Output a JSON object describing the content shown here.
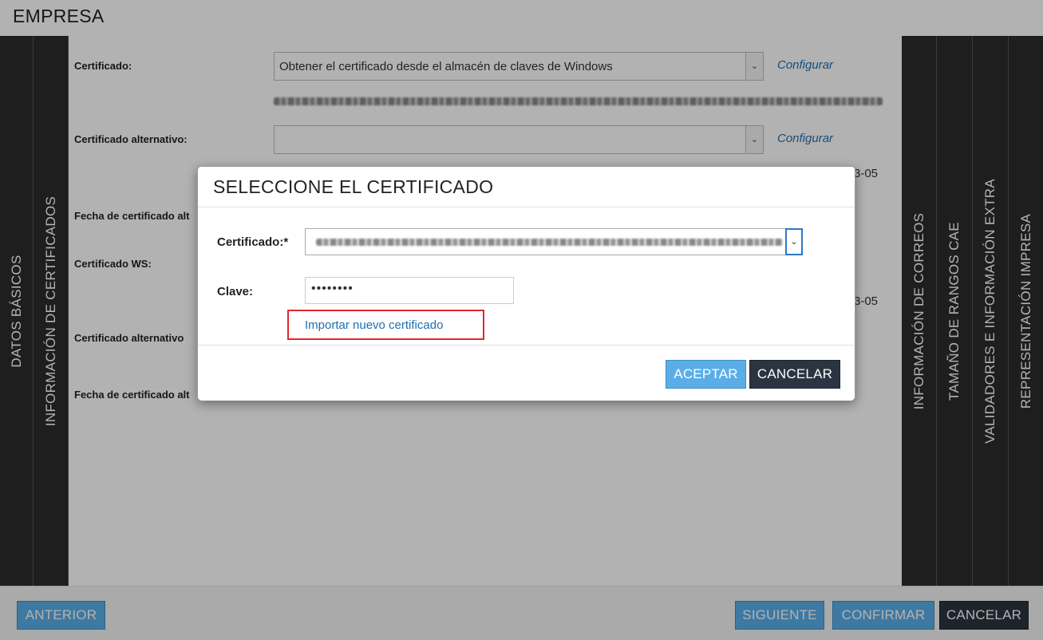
{
  "app": {
    "title": "EMPRESA"
  },
  "left_tabs": [
    "DATOS BÁSICOS",
    "INFORMACIÓN DE CERTIFICADOS"
  ],
  "right_tabs": [
    "INFORMACIÓN DE CORREOS",
    "TAMAÑO DE RANGOS CAE",
    "VALIDADORES E INFORMACIÓN EXTRA",
    "REPRESENTACIÓN IMPRESA"
  ],
  "form": {
    "certificado_label": "Certificado:",
    "certificado_value": "Obtener el certificado desde el almacén de claves de Windows",
    "configurar": "Configurar",
    "cert_alt_label": "Certificado alternativo:",
    "cert_alt_value": "",
    "fecha_label": "Fecha de certificado alt",
    "date_suffix_1": "3-05",
    "cert_ws_label": "Certificado WS:",
    "date_suffix_2": "3-05",
    "cert_alt2_label": "Certificado alternativo",
    "fecha2_label": "Fecha de certificado alt"
  },
  "modal": {
    "title": "SELECCIONE EL CERTIFICADO",
    "cert_label": "Certificado:*",
    "clave_label": "Clave:",
    "clave_value": "••••••••",
    "import_link": "Importar nuevo certificado",
    "accept": "ACEPTAR",
    "cancel": "CANCELAR"
  },
  "footer": {
    "anterior": "ANTERIOR",
    "siguiente": "SIGUIENTE",
    "confirmar": "CONFIRMAR",
    "cancelar": "CANCELAR"
  },
  "colors": {
    "accent_blue": "#5aaee8",
    "dark_button": "#2b3440",
    "link": "#1e6fb0",
    "highlight_red": "#e0282e"
  }
}
